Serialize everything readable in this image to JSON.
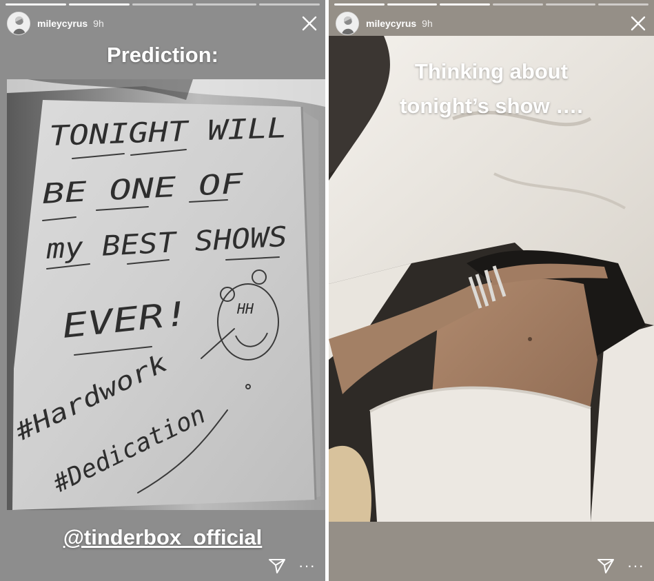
{
  "stories": [
    {
      "user": {
        "username": "mileycyrus",
        "time": "9h"
      },
      "progress": {
        "segments": 5,
        "active": 2
      },
      "caption_title": "Prediction:",
      "note_lines": [
        "TONIGHT WILL",
        "BE ONE OF",
        "my BEST SHOWS",
        "EVER!",
        "#Hardwork",
        "#Dedication"
      ],
      "doodle_text": "HH",
      "mention": "@tinderbox_official",
      "icons": {
        "close": "close-icon",
        "send": "send-icon",
        "more": "more-icon"
      }
    },
    {
      "user": {
        "username": "mileycyrus",
        "time": "9h"
      },
      "progress": {
        "segments": 6,
        "active": 3
      },
      "caption_line1": "Thinking about",
      "caption_line2": "tonight’s show ….",
      "icons": {
        "close": "close-icon",
        "send": "send-icon",
        "more": "more-icon"
      }
    }
  ],
  "colors": {
    "left_bg": "#8d8d8d",
    "right_bg": "#958f87",
    "text": "#ffffff",
    "ink": "#2b2b2b"
  },
  "more_glyph": "···"
}
